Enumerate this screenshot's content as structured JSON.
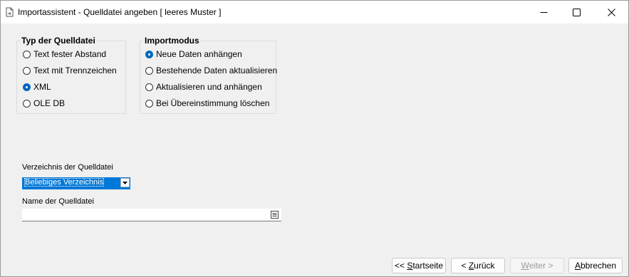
{
  "window": {
    "title": "Importassistent - Quelldatei angeben [ leeres Muster ]"
  },
  "source_type": {
    "legend": "Typ der Quelldatei",
    "options": [
      {
        "label": "Text fester Abstand",
        "checked": false
      },
      {
        "label": "Text mit Trennzeichen",
        "checked": false
      },
      {
        "label": "XML",
        "checked": true
      },
      {
        "label": "OLE DB",
        "checked": false
      }
    ]
  },
  "import_mode": {
    "legend": "Importmodus",
    "options": [
      {
        "label": "Neue Daten anhängen",
        "checked": true
      },
      {
        "label": "Bestehende Daten aktualisieren",
        "checked": false
      },
      {
        "label": "Aktualisieren und anhängen",
        "checked": false
      },
      {
        "label": "Bei Übereinstimmung löschen",
        "checked": false
      }
    ]
  },
  "source_dir": {
    "label": "Verzeichnis der Quelldatei",
    "selected": "Beliebiges Verzeichnis"
  },
  "source_name": {
    "label": "Name der Quelldatei",
    "value": ""
  },
  "buttons": {
    "start_prefix": "<< ",
    "start_hotkey": "S",
    "start_rest": "tartseite",
    "back_prefix": "< ",
    "back_hotkey": "Z",
    "back_rest": "urück",
    "next_hotkey": "W",
    "next_rest": "eiter >",
    "cancel_hotkey": "A",
    "cancel_rest": "bbrechen"
  },
  "colors": {
    "accent": "#0078d7",
    "radio_checked": "#0067c0"
  },
  "icons": {
    "app": "document-import-icon",
    "minimize": "minimize-icon",
    "maximize": "maximize-icon",
    "close": "close-icon",
    "dropdown": "chevron-down-icon",
    "browse": "list-browse-icon"
  }
}
